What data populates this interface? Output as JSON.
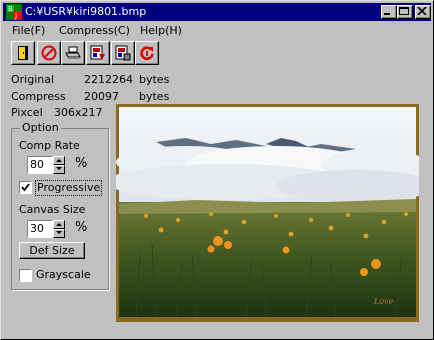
{
  "window": {
    "title": "C:¥USR¥kiri9801.bmp",
    "controls": {
      "minimize": "minimize",
      "maximize": "maximize",
      "close": "close"
    }
  },
  "menu": {
    "file": "File(F)",
    "compress": "Compress(C)",
    "help": "Help(H)"
  },
  "toolbar": {
    "icons": [
      "open-door-icon",
      "stop-icon",
      "printer-icon",
      "compress-image-icon",
      "save-image-icon",
      "refresh-icon"
    ]
  },
  "info": {
    "original_label": "Original",
    "original_value": "2212264",
    "original_unit": "bytes",
    "compress_label": "Compress",
    "compress_value": "20097",
    "compress_unit": "bytes",
    "pixcel_label": "Pixcel",
    "pixcel_value": "306x217"
  },
  "option": {
    "title": "Option",
    "comp_rate_label": "Comp Rate",
    "comp_rate_value": "80",
    "comp_rate_unit": "%",
    "progressive_label": "Progressive",
    "progressive_checked": true,
    "canvas_size_label": "Canvas Size",
    "canvas_size_value": "30",
    "canvas_size_unit": "%",
    "def_size_label": "Def  Size",
    "grayscale_label": "Grayscale",
    "grayscale_checked": false
  },
  "colors": {
    "titlebar": "#000080",
    "face": "#c0c0c0",
    "frame": "#8a6a22"
  }
}
